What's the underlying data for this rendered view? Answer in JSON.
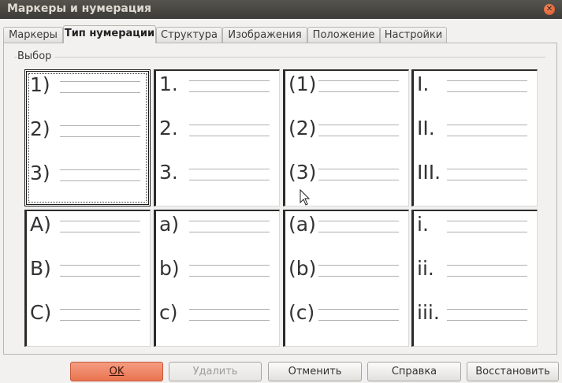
{
  "window": {
    "title": "Маркеры и нумерация"
  },
  "tabs": [
    {
      "label": "Маркеры"
    },
    {
      "label": "Тип нумерации"
    },
    {
      "label": "Структура"
    },
    {
      "label": "Изображения"
    },
    {
      "label": "Положение"
    },
    {
      "label": "Настройки"
    }
  ],
  "active_tab": "Тип нумерации",
  "selection": {
    "group_label": "Выбор",
    "cells": [
      {
        "items": [
          "1)",
          "2)",
          "3)"
        ],
        "selected": true
      },
      {
        "items": [
          "1.",
          "2.",
          "3."
        ]
      },
      {
        "items": [
          "(1)",
          "(2)",
          "(3)"
        ]
      },
      {
        "items": [
          "I.",
          "II.",
          "III."
        ]
      },
      {
        "items": [
          "A)",
          "B)",
          "C)"
        ]
      },
      {
        "items": [
          "a)",
          "b)",
          "c)"
        ]
      },
      {
        "items": [
          "(a)",
          "(b)",
          "(c)"
        ]
      },
      {
        "items": [
          "i.",
          "ii.",
          "iii."
        ]
      }
    ]
  },
  "buttons": {
    "ok": "OK",
    "delete": "Удалить",
    "cancel": "Отменить",
    "help": "Справка",
    "reset": "Восстановить"
  },
  "colors": {
    "accent": "#e9744f",
    "titlebar": "#3d3c38"
  }
}
